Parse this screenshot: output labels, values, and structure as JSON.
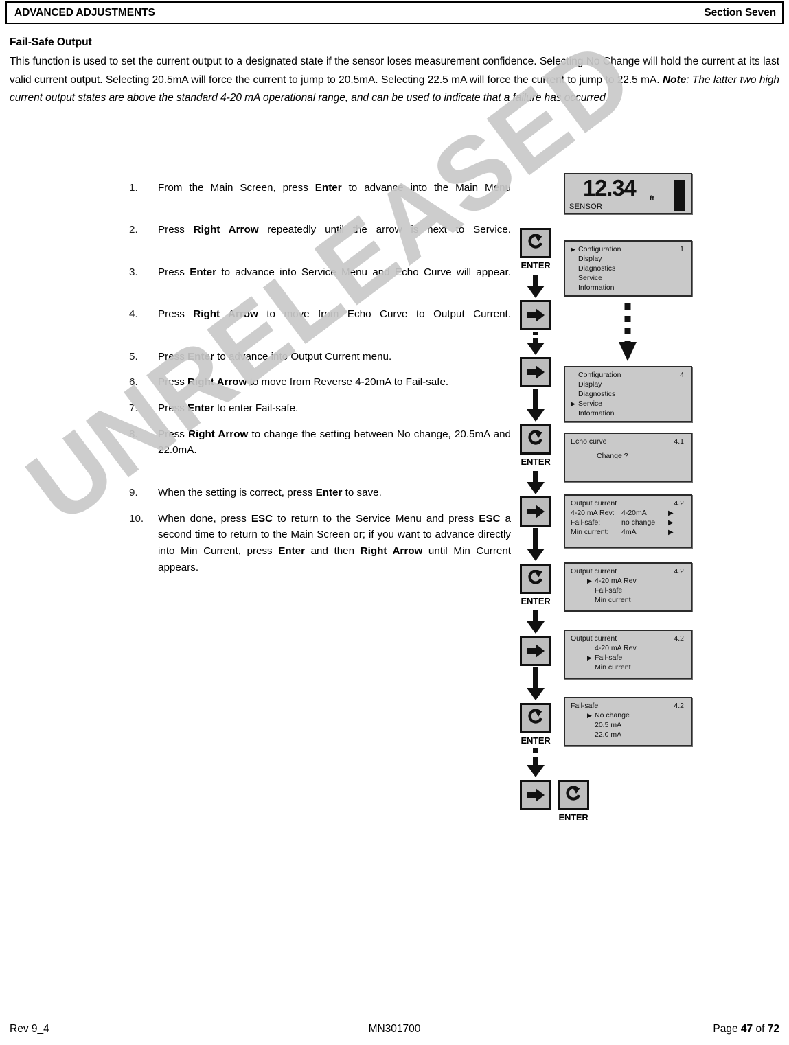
{
  "header": {
    "left": "ADVANCED ADJUSTMENTS",
    "right": "Section Seven"
  },
  "section": {
    "title": "Fail-Safe Output",
    "paragraph_part1": "This function is used to set the current output to a designated state if the sensor loses measurement confidence.  Selecting No Change will hold the current at its last valid current output.  Selecting 20.5mA will force the current to jump to 20.5mA.  Selecting 22.5 mA will force the current to jump to 22.5 mA.  ",
    "note_lead": "Note",
    "note_text": ": The latter two high current output states are above the standard 4-20 mA operational range, and can be used to indicate that a failure has occurred."
  },
  "steps": [
    {
      "num": "1.",
      "parts": [
        {
          "t": "From the Main Screen, press ",
          "b": false
        },
        {
          "t": "Enter",
          "b": true
        },
        {
          "t": " to advance into the Main Menu",
          "b": false
        }
      ]
    },
    {
      "num": "2.",
      "parts": [
        {
          "t": "Press ",
          "b": false
        },
        {
          "t": "Right Arrow",
          "b": true
        },
        {
          "t": " repeatedly until the arrow is next to Service.",
          "b": false
        }
      ]
    },
    {
      "num": "3.",
      "parts": [
        {
          "t": "Press ",
          "b": false
        },
        {
          "t": "Enter",
          "b": true
        },
        {
          "t": " to advance into Service Menu and Echo Curve will appear.",
          "b": false
        }
      ]
    },
    {
      "num": "4.",
      "parts": [
        {
          "t": "Press ",
          "b": false
        },
        {
          "t": "Right Arrow",
          "b": true
        },
        {
          "t": " to move from Echo Curve to Output Current.",
          "b": false
        }
      ]
    },
    {
      "num": "5.",
      "parts": [
        {
          "t": "Press ",
          "b": false
        },
        {
          "t": "Enter",
          "b": true
        },
        {
          "t": " to advance into Output Current menu.",
          "b": false
        }
      ]
    },
    {
      "num": "6.",
      "parts": [
        {
          "t": "Press ",
          "b": false
        },
        {
          "t": "Right Arrow",
          "b": true
        },
        {
          "t": " to move from Reverse 4-20mA to Fail-safe.",
          "b": false
        }
      ]
    },
    {
      "num": "7.",
      "parts": [
        {
          "t": "Press ",
          "b": false
        },
        {
          "t": "Enter",
          "b": true
        },
        {
          "t": " to enter Fail-safe.",
          "b": false
        }
      ]
    },
    {
      "num": "8.",
      "parts": [
        {
          "t": "Press ",
          "b": false
        },
        {
          "t": "Right Arrow",
          "b": true
        },
        {
          "t": " to change the setting between No change, 20.5mA and 22.0mA.",
          "b": false
        }
      ]
    },
    {
      "num": "9.",
      "parts": [
        {
          "t": "When the setting is correct, press ",
          "b": false
        },
        {
          "t": "Enter",
          "b": true
        },
        {
          "t": " to save.",
          "b": false
        }
      ]
    },
    {
      "num": "10.",
      "parts": [
        {
          "t": "When done, press ",
          "b": false
        },
        {
          "t": "ESC",
          "b": true
        },
        {
          "t": " to return to the Service Menu and press ",
          "b": false
        },
        {
          "t": "ESC",
          "b": true
        },
        {
          "t": " a second time to return to the Main Screen or; if you want to advance directly into Min Current, press ",
          "b": false
        },
        {
          "t": "Enter",
          "b": true
        },
        {
          "t": " and then ",
          "b": false
        },
        {
          "t": "Right Arrow",
          "b": true
        },
        {
          "t": " until Min Current appears.",
          "b": false
        }
      ]
    }
  ],
  "watermark": {
    "text": "UNRELEASED",
    "color": "#c9c9c9"
  },
  "diagram": {
    "enter_label": "ENTER",
    "screens": {
      "main": {
        "value": "12.34",
        "unit": "ft",
        "label": "SENSOR"
      },
      "menu1": {
        "index": "1",
        "rows": [
          {
            "caret": true,
            "label": "Configuration"
          },
          {
            "caret": false,
            "label": "Display"
          },
          {
            "caret": false,
            "label": "Diagnostics"
          },
          {
            "caret": false,
            "label": "Service"
          },
          {
            "caret": false,
            "label": "Information"
          }
        ]
      },
      "menu4": {
        "index": "4",
        "rows": [
          {
            "caret": false,
            "label": "Configuration"
          },
          {
            "caret": false,
            "label": "Display"
          },
          {
            "caret": false,
            "label": "Diagnostics"
          },
          {
            "caret": true,
            "label": "Service"
          },
          {
            "caret": false,
            "label": "Information"
          }
        ]
      },
      "echo": {
        "index": "4.1",
        "title": "Echo curve",
        "body": "Change ?"
      },
      "output_summary": {
        "index": "4.2",
        "title": "Output current",
        "rows": [
          {
            "label": "4-20 mA Rev:",
            "value": "4-20mA",
            "arrow": "▶"
          },
          {
            "label": "Fail-safe:",
            "value": "no change",
            "arrow": "▶"
          },
          {
            "label": "Min current:",
            "value": "4mA",
            "arrow": "▶"
          }
        ]
      },
      "output_sel_rev": {
        "index": "4.2",
        "title": "Output current",
        "rows": [
          {
            "caret": true,
            "label": "4-20 mA Rev"
          },
          {
            "caret": false,
            "label": "Fail-safe"
          },
          {
            "caret": false,
            "label": "Min current"
          }
        ]
      },
      "output_sel_fs": {
        "index": "4.2",
        "title": "Output current",
        "rows": [
          {
            "caret": false,
            "label": "4-20 mA Rev"
          },
          {
            "caret": true,
            "label": "Fail-safe"
          },
          {
            "caret": false,
            "label": "Min current"
          }
        ]
      },
      "failsafe": {
        "index": "4.2",
        "title": "Fail-safe",
        "rows": [
          {
            "caret": true,
            "label": "No change"
          },
          {
            "caret": false,
            "label": "20.5 mA"
          },
          {
            "caret": false,
            "label": "22.0 mA"
          }
        ]
      }
    }
  },
  "footer": {
    "left": "Rev 9_4",
    "center": "MN301700",
    "right_pre": "Page ",
    "right_page": "47",
    "right_mid": " of ",
    "right_total": "72"
  }
}
